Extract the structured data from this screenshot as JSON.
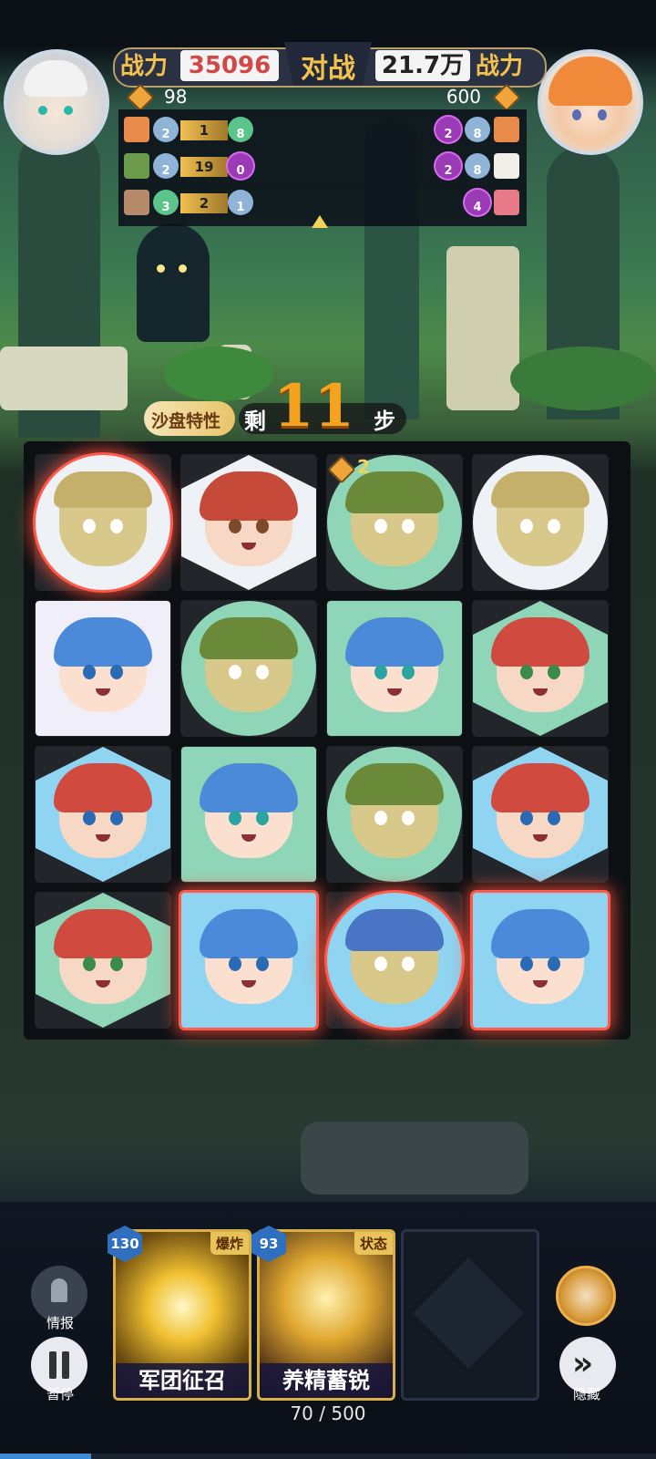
{
  "header": {
    "left_power_label": "战力",
    "left_power_value": "35096",
    "vs_label": "对战",
    "right_power_value": "21.7万",
    "right_power_label": "战力",
    "left_energy": "98",
    "right_energy": "600"
  },
  "stats": {
    "left_rows": [
      {
        "a": "2",
        "bar": "1",
        "b": "8"
      },
      {
        "a": "2",
        "bar": "19",
        "b": "0"
      },
      {
        "a": "3",
        "bar": "2",
        "b": "1"
      }
    ],
    "right_rows": [
      {
        "a": "2",
        "b": "8"
      },
      {
        "a": "2",
        "b": "8"
      },
      {
        "a": "4"
      }
    ]
  },
  "sandbox": {
    "feature_label": "沙盘特性",
    "remaining_label": "剩",
    "steps": "11",
    "steps_unit": "步"
  },
  "board": {
    "badge_value": "2"
  },
  "cards": [
    {
      "cost": "130",
      "tag": "爆炸",
      "name": "军团征召"
    },
    {
      "cost": "93",
      "tag": "状态",
      "name": "养精蓄锐"
    }
  ],
  "buttons": {
    "info": "情报",
    "pause": "暂停",
    "hide": "隐藏"
  },
  "counter": "70 / 500",
  "colors": {
    "accent_gold": "#f3c24e",
    "power_red": "#d04848",
    "highlight_glow": "#ff5a4a",
    "tile_green": "#8fd6b8",
    "tile_blue": "#8fd4f0"
  }
}
